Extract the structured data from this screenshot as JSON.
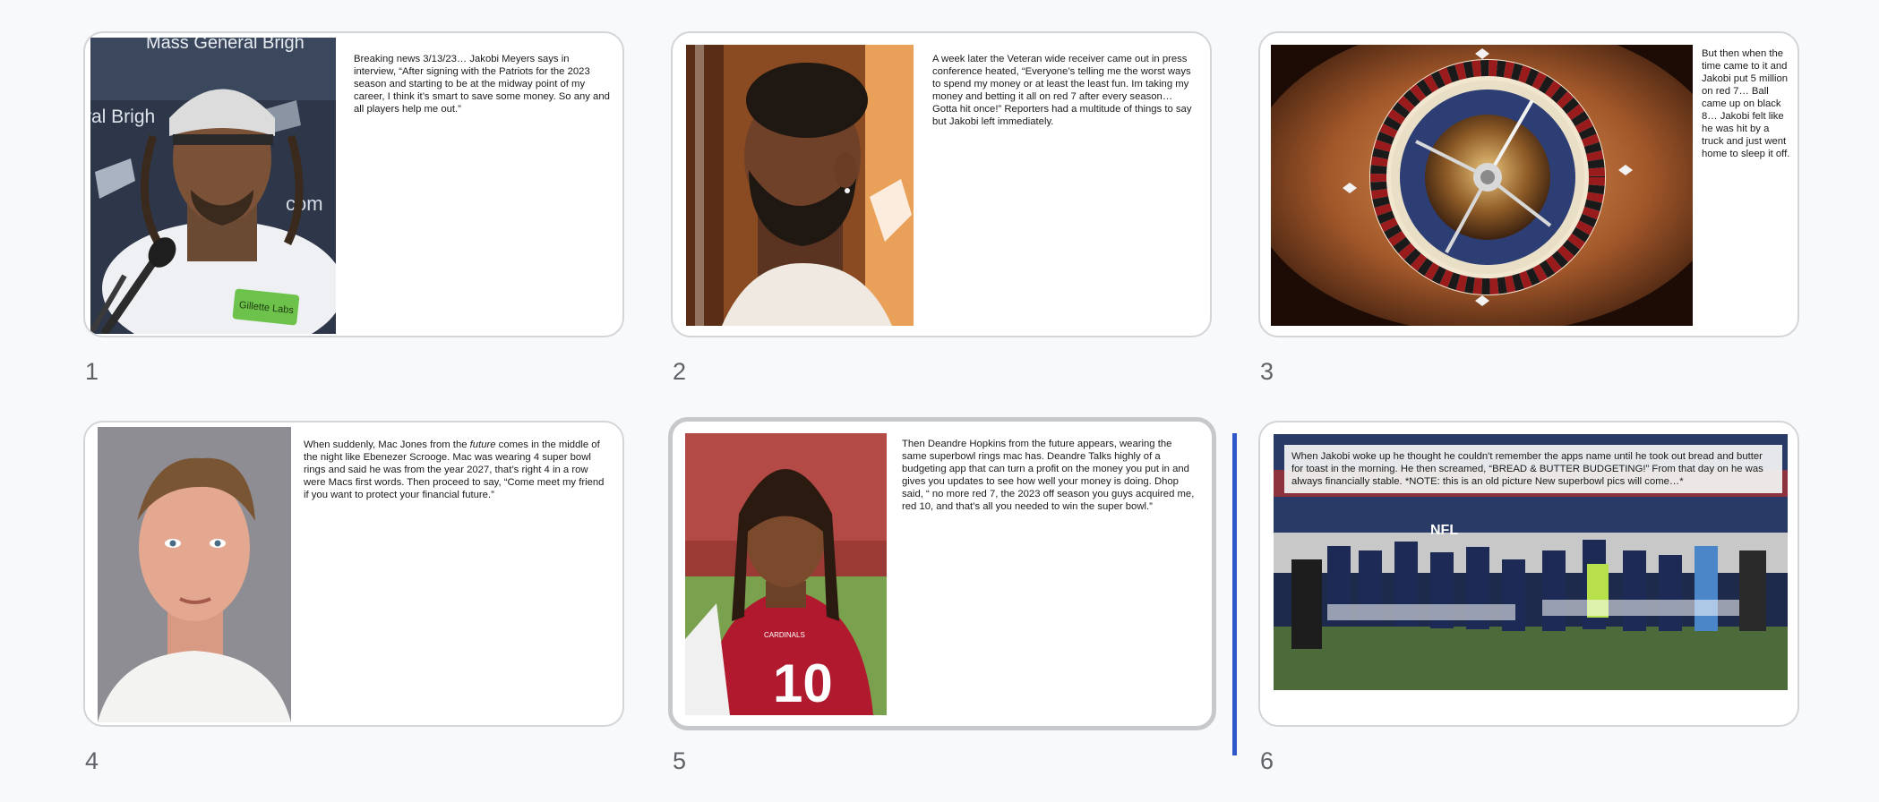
{
  "slides": [
    {
      "number": "1",
      "caption": "Breaking news 3/13/23… Jakobi Meyers says in interview, “After signing with the Patriots for the 2023 season and starting to be at the midway point of my career, I think it’s smart to save some money. So any and all players help me out.”",
      "image": "jakobi-press-conference",
      "image_text": [
        "Mass General Brigh",
        "ral Brigh",
        "com",
        "Gillette Labs"
      ]
    },
    {
      "number": "2",
      "caption": "A week later the Veteran wide receiver came out in press conference heated, “Everyone’s telling me the worst ways to spend my money or at least the least fun. Im taking my money and betting it all on red 7 after every season… Gotta hit once!” Reporters had a multitude of things to say but Jakobi left immediately.",
      "image": "jakobi-portrait"
    },
    {
      "number": "3",
      "caption": "But then when the time came to it and Jakobi put 5 million on red 7… Ball came up on black 8… Jakobi felt like he was hit by a truck and just went home to sleep it off.",
      "image": "roulette-wheel"
    },
    {
      "number": "4",
      "caption_before": "When suddenly, Mac Jones from the ",
      "caption_italic": "future",
      "caption_after": " comes in the middle of the night like Ebenezer Scrooge. Mac was wearing 4 super bowl rings and said he was from the year 2027, that’s right 4 in a row were Macs first words. Then proceed to say, “Come meet my friend if you want to protect your financial future.”",
      "image": "mac-jones-portrait"
    },
    {
      "number": "5",
      "caption": "Then Deandre Hopkins from the future appears, wearing the same superbowl rings mac has. Deandre Talks  highly of a budgeting app that can turn a profit on the money you put in and gives you updates to see how well your money is doing. Dhop said, “ no more red 7, the 2023 off season you guys acquired me, red 10, and that’s all you needed to win the super bowl.”",
      "image": "deandre-hopkins-cardinals",
      "image_text": [
        "CARDINALS",
        "10"
      ]
    },
    {
      "number": "6",
      "caption": "When Jakobi woke up he thought he couldn't remember the apps name until he took out bread and butter for toast in the morning. He then screamed, “BREAD & BUTTER BUDGETING!” From that day on he was always financially stable. *NOTE: this is an old picture New superbowl pics will come…*",
      "image": "patriots-team-entrance",
      "image_text": [
        "NFL"
      ]
    }
  ],
  "colors": {
    "background": "#f8f9fb",
    "card_border": "#d3d5d9",
    "selected_border": "#c6c8cc",
    "drop_indicator": "#2f59c9",
    "number_text": "#5f6368"
  },
  "state": {
    "selected_slide": "5"
  }
}
